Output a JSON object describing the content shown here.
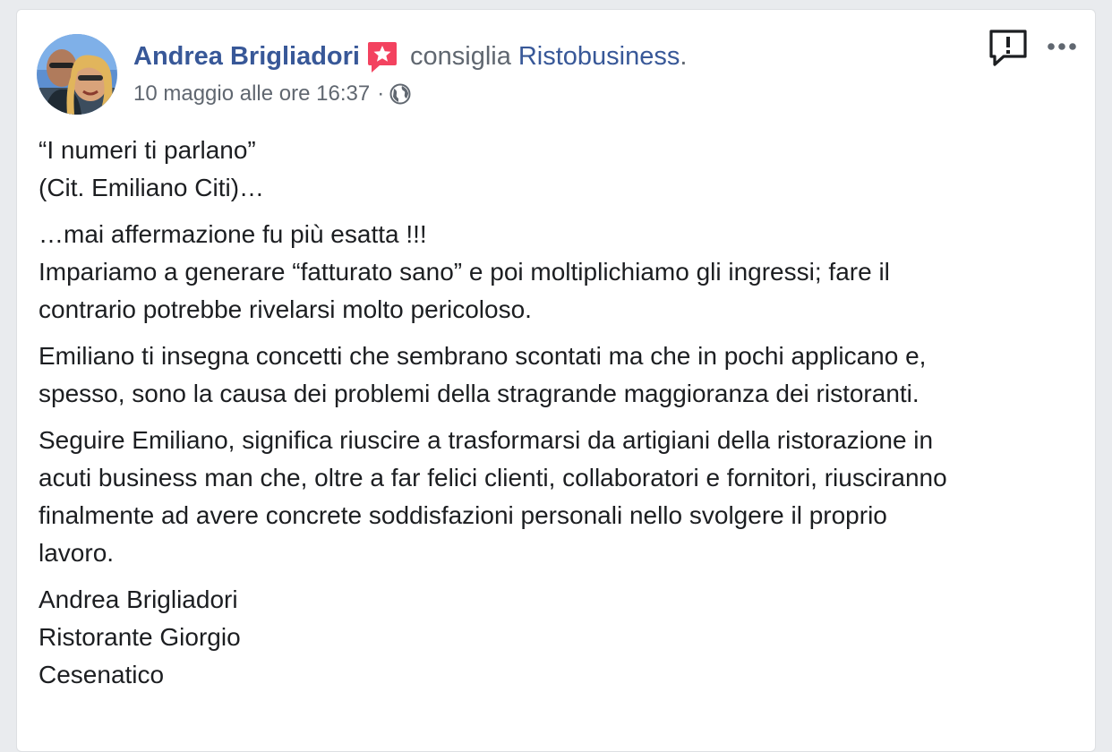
{
  "post": {
    "author": "Andrea Brigliadori",
    "recommend_verb": "consiglia",
    "page_name": "Ristobusiness",
    "period": ".",
    "timestamp": "10 maggio alle ore 16:37",
    "separator": "·",
    "privacy_icon": "globe-icon",
    "badge_icon": "recommendation-star-icon",
    "actions": {
      "report_icon": "report-speech-bubble-icon",
      "more_icon": "more-options-icon"
    },
    "paragraphs": [
      [
        "“I numeri ti parlano”",
        "(Cit. Emiliano Citi)…"
      ],
      [
        "…mai affermazione fu più esatta !!!",
        "Impariamo a generare “fatturato sano” e poi moltiplichiamo gli ingressi; fare il",
        "contrario potrebbe rivelarsi molto pericoloso."
      ],
      [
        "Emiliano ti insegna concetti che sembrano scontati ma che in pochi applicano e,",
        "spesso, sono la causa dei problemi della stragrande maggioranza dei ristoranti."
      ],
      [
        "Seguire Emiliano, significa riuscire a trasformarsi da artigiani della ristorazione in",
        "acuti business man che, oltre a far felici clienti, collaboratori e fornitori, riusciranno",
        "finalmente ad avere concrete soddisfazioni personali nello svolgere il proprio",
        "lavoro."
      ],
      [
        "Andrea Brigliadori",
        "Ristorante Giorgio",
        "Cesenatico"
      ]
    ]
  },
  "colors": {
    "link": "#385898",
    "secondary_text": "#606770",
    "body_text": "#1c1e21",
    "badge": "#f3425f",
    "background": "#e9ebee"
  }
}
